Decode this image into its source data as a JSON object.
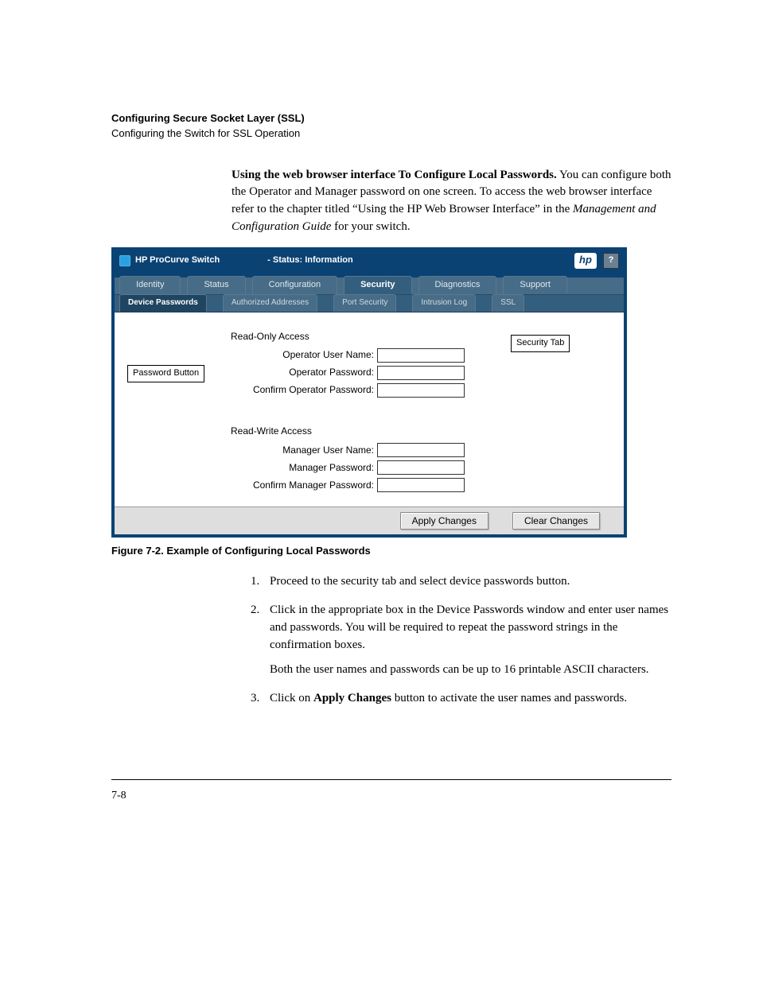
{
  "header": {
    "title": "Configuring Secure Socket Layer (SSL)",
    "subtitle": "Configuring the Switch for SSL Operation"
  },
  "intro": {
    "lead": "Using the web browser interface To Configure Local Passwords.",
    "body_a": " You can configure both the Operator and Manager password on one screen. To access the web browser interface refer to the  chapter titled “Using the HP Web Browser Interface” in the ",
    "italic": "Management and Configuration Guide",
    "body_b": " for your switch."
  },
  "app": {
    "title_prefix": "HP ProCurve Switch",
    "title_status": "- Status: Information",
    "hp_logo_text": "hp",
    "help_text": "?",
    "main_tabs": {
      "identity": "Identity",
      "status": "Status",
      "configuration": "Configuration",
      "security": "Security",
      "diagnostics": "Diagnostics",
      "support": "Support"
    },
    "sub_tabs": {
      "device_passwords": "Device Passwords",
      "authorized_addresses": "Authorized Addresses",
      "port_security": "Port Security",
      "intrusion_log": "Intrusion Log",
      "ssl": "SSL"
    },
    "form": {
      "read_only_title": "Read-Only Access",
      "operator_user_label": "Operator User Name:",
      "operator_pw_label": "Operator Password:",
      "confirm_operator_pw_label": "Confirm Operator Password:",
      "read_write_title": "Read-Write Access",
      "manager_user_label": "Manager User Name:",
      "manager_pw_label": "Manager Password:",
      "confirm_manager_pw_label": "Confirm Manager Password:",
      "operator_user_value": "",
      "operator_pw_value": "",
      "confirm_operator_pw_value": "",
      "manager_user_value": "",
      "manager_pw_value": "",
      "confirm_manager_pw_value": ""
    },
    "buttons": {
      "apply": "Apply Changes",
      "clear": "Clear Changes"
    }
  },
  "callouts": {
    "password_button": "Password Button",
    "security_tab": "Security Tab"
  },
  "figure_caption": "Figure 7-2. Example of Configuring Local Passwords",
  "steps": {
    "s1": "Proceed to the security tab and select device passwords button.",
    "s2": "Click in the appropriate box in the Device Passwords window and enter user names and passwords. You will be required to repeat the password strings in the confirmation boxes.",
    "s2_sub": "Both the user names and passwords can be up to 16 printable ASCII characters.",
    "s3_a": "Click on ",
    "s3_bold": "Apply Changes",
    "s3_b": "  button to activate the user names and passwords."
  },
  "page_number": "7-8"
}
